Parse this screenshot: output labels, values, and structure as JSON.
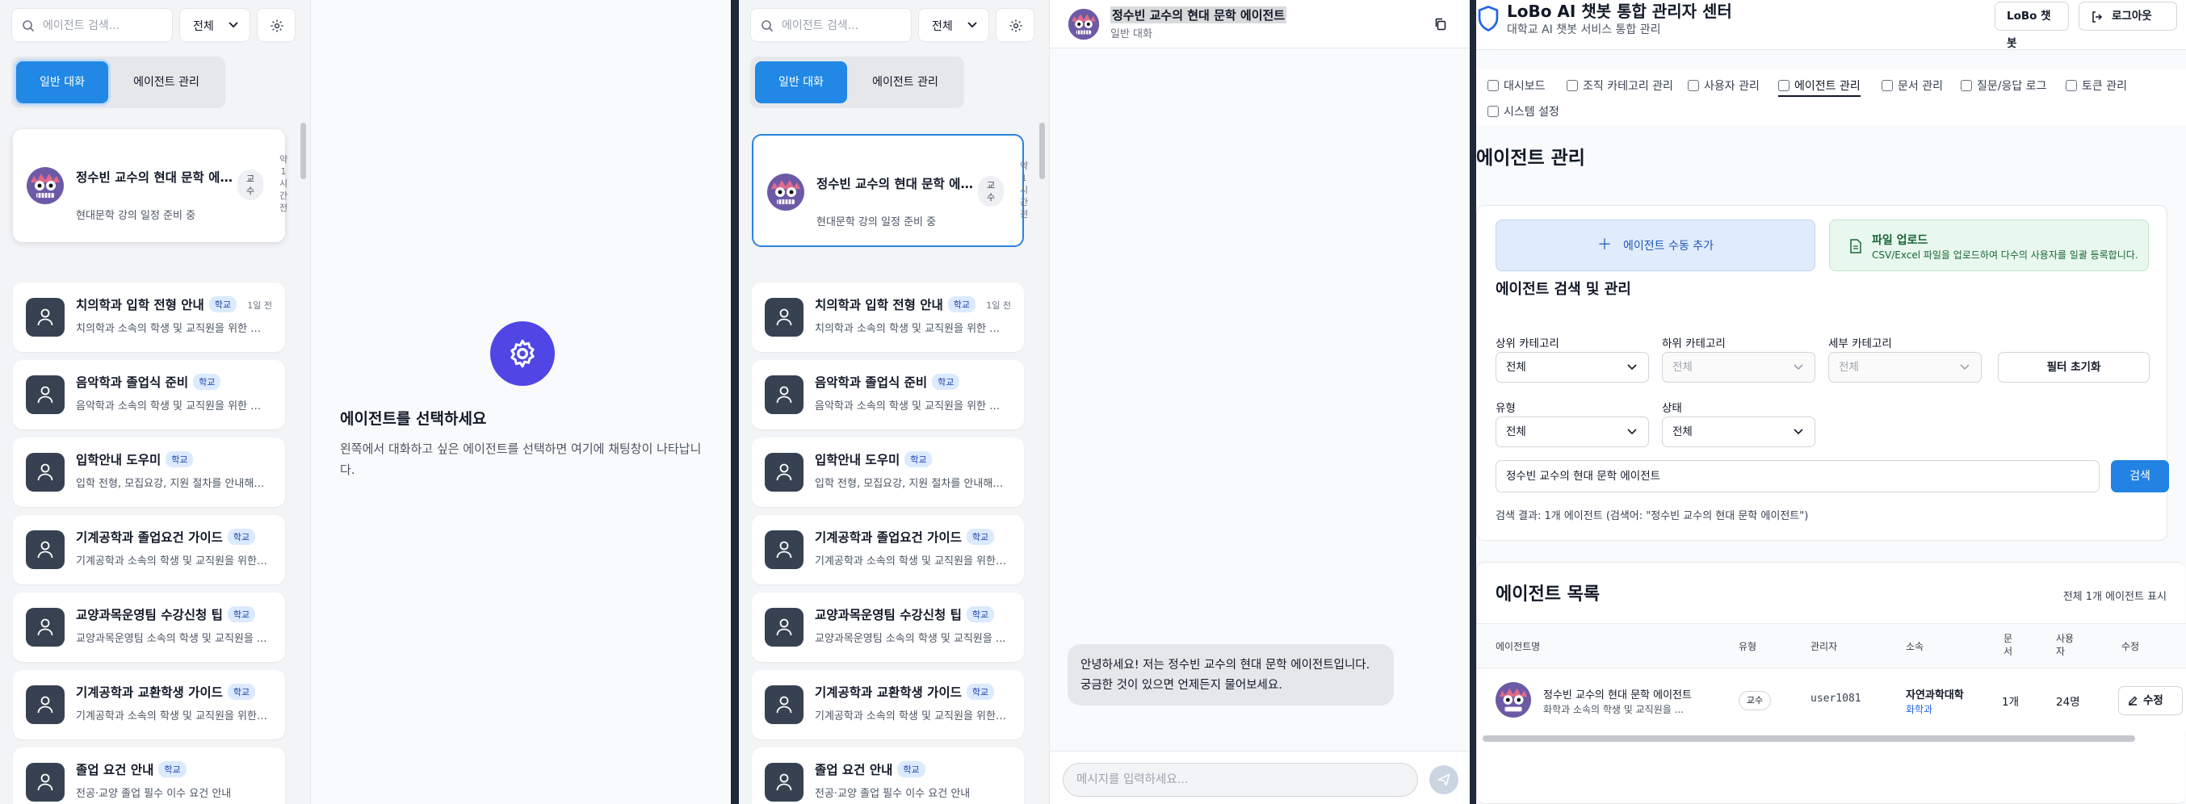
{
  "chat_app": {
    "search_placeholder": "에이전트 검색...",
    "filter_value": "전체",
    "tabs": [
      "일반 대화",
      "에이전트 관리"
    ],
    "agents": [
      {
        "title": "정수빈 교수의 현대 문학 에이...",
        "badge": "교수",
        "time": "약 1 시간 전",
        "desc": "현대문학 강의 일정 준비 중"
      },
      {
        "title": "치의학과 입학 전형 안내",
        "badge": "학교",
        "time": "1일 전",
        "desc": "치의학과 소속의 학생 및 교직원을 위한 입..."
      },
      {
        "title": "음악학과 졸업식 준비",
        "badge": "학교",
        "time": "",
        "desc": "음악학과 소속의 학생 및 교직원을 위한 졸..."
      },
      {
        "title": "입학안내 도우미",
        "badge": "학교",
        "time": "",
        "desc": "입학 전형, 모집요강, 지원 절차를 안내해주..."
      },
      {
        "title": "기계공학과 졸업요건 가이드",
        "badge": "학교",
        "time": "",
        "desc": "기계공학과 소속의 학생 및 교직원을 위한 ..."
      },
      {
        "title": "교양과목운영팀 수강신청 팁",
        "badge": "학교",
        "time": "",
        "desc": "교양과목운영팀 소속의 학생 및 교직원을 ..."
      },
      {
        "title": "기계공학과 교환학생 가이드",
        "badge": "학교",
        "time": "",
        "desc": "기계공학과 소속의 학생 및 교직원을 위한 ..."
      },
      {
        "title": "졸업 요건 안내",
        "badge": "학교",
        "time": "",
        "desc": "전공·교양 졸업 필수 이수 요건 안내"
      }
    ],
    "empty_title": "에이전트를 선택하세요",
    "empty_desc": "왼쪽에서 대화하고 싶은 에이전트를 선택하면 여기에 채팅창이 나타납니다."
  },
  "chat": {
    "title": "정수빈 교수의 현대 문학 에이전트",
    "subtitle": "일반 대화",
    "message": "안녕하세요! 저는 정수빈 교수의 현대 문학 에이전트입니다. 궁금한 것이 있으면 언제든지 물어보세요.",
    "input_placeholder": "메시지를 입력하세요..."
  },
  "admin": {
    "title": "LoBo AI 챗봇 통합 관리자 센터",
    "subtitle": "대학교 AI 챗봇 서비스 통합 관리",
    "header_buttons": [
      "LoBo 챗봇",
      "로그아웃"
    ],
    "nav": [
      "대시보드",
      "조직 카테고리 관리",
      "사용자 관리",
      "에이전트 관리",
      "문서 관리",
      "질문/응답 로그",
      "토큰 관리",
      "시스템 설정"
    ],
    "page_title": "에이전트 관리",
    "add_label": "에이전트 수동 추가",
    "upload_title": "파일 업로드",
    "upload_desc": "CSV/Excel 파일을 업로드하여 다수의 사용자를 일괄 등록합니다.",
    "search_section": "에이전트 검색 및 관리",
    "filters": {
      "upper_label": "상위 카테고리",
      "upper_value": "전체",
      "lower_label": "하위 카테고리",
      "lower_value": "전체",
      "detail_label": "세부 카테고리",
      "detail_value": "전체",
      "reset": "필터 초기화",
      "type_label": "유형",
      "type_value": "전체",
      "status_label": "상태",
      "status_value": "전체"
    },
    "query": "정수빈 교수의 현대 문학 에이전트",
    "search_btn": "검색",
    "result": "검색 결과: 1개 에이전트 (검색어: \"정수빈 교수의 현대 문학 에이전트\")",
    "list_title": "에이전트 목록",
    "list_count": "전체 1개 에이전트 표시",
    "columns": [
      "에이전트명",
      "유형",
      "관리자",
      "소속",
      "문서",
      "사용자",
      "수정"
    ],
    "row": {
      "name": "정수빈 교수의 현대 문학 에이전트",
      "desc": "화학과 소속의 학생 및 교직원을 ...",
      "type": "교수",
      "admin": "user1081",
      "org": "자연과학대학",
      "dept": "화학과",
      "docs": "1개",
      "users": "24명",
      "edit": "수정"
    }
  }
}
